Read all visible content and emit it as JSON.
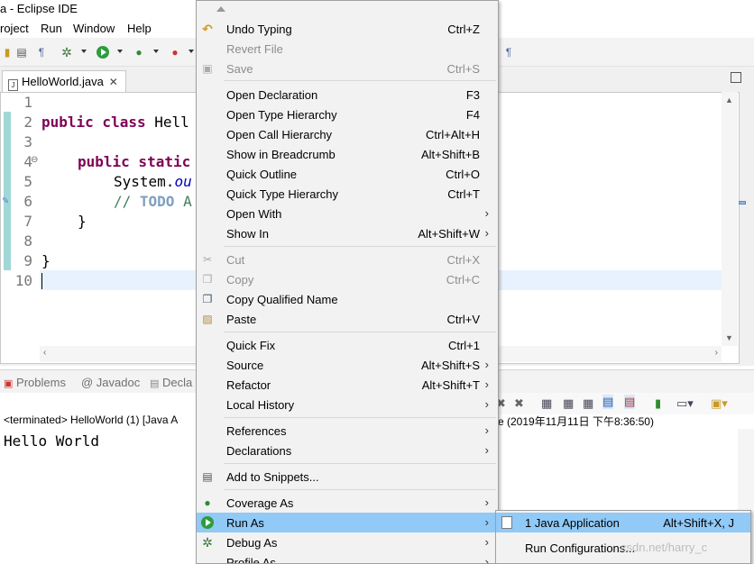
{
  "window": {
    "title": "a - Eclipse IDE"
  },
  "menubar": {
    "items": [
      "roject",
      "Run",
      "Window",
      "Help"
    ]
  },
  "editor": {
    "tab_label": "HelloWorld.java",
    "lines": [
      {
        "num": "1"
      },
      {
        "num": "2"
      },
      {
        "num": "3"
      },
      {
        "num": "4"
      },
      {
        "num": "5"
      },
      {
        "num": "6"
      },
      {
        "num": "7"
      },
      {
        "num": "8"
      },
      {
        "num": "9"
      },
      {
        "num": "10"
      }
    ],
    "code": {
      "l2_kw": "public class ",
      "l2_rest": "Hell",
      "l4_kw": "public static",
      "l5_a": "System.",
      "l5_b": "ou",
      "l6_a": "// ",
      "l6_b": "TODO",
      "l6_c": " A",
      "l7": "}",
      "l9": "}"
    }
  },
  "panel": {
    "tabs": [
      "Problems",
      "@ Javadoc",
      "Decla"
    ],
    "console_head_left": "<terminated> HelloWorld (1) [Java A",
    "console_head_right": "e (2019年11月11日 下午8:36:50)",
    "output": "Hello World"
  },
  "context_menu": {
    "items": [
      {
        "label": "Undo Typing",
        "shortcut": "Ctrl+Z",
        "icon": "undo-icon",
        "disabled": false,
        "submenu": false
      },
      {
        "label": "Revert File",
        "shortcut": "",
        "icon": "",
        "disabled": true,
        "submenu": false
      },
      {
        "label": "Save",
        "shortcut": "Ctrl+S",
        "icon": "save-icon",
        "disabled": true,
        "submenu": false
      },
      {
        "label": "Open Declaration",
        "shortcut": "F3",
        "icon": "",
        "disabled": false,
        "submenu": false
      },
      {
        "label": "Open Type Hierarchy",
        "shortcut": "F4",
        "icon": "",
        "disabled": false,
        "submenu": false
      },
      {
        "label": "Open Call Hierarchy",
        "shortcut": "Ctrl+Alt+H",
        "icon": "",
        "disabled": false,
        "submenu": false
      },
      {
        "label": "Show in Breadcrumb",
        "shortcut": "Alt+Shift+B",
        "icon": "",
        "disabled": false,
        "submenu": false
      },
      {
        "label": "Quick Outline",
        "shortcut": "Ctrl+O",
        "icon": "",
        "disabled": false,
        "submenu": false
      },
      {
        "label": "Quick Type Hierarchy",
        "shortcut": "Ctrl+T",
        "icon": "",
        "disabled": false,
        "submenu": false
      },
      {
        "label": "Open With",
        "shortcut": "",
        "icon": "",
        "disabled": false,
        "submenu": true
      },
      {
        "label": "Show In",
        "shortcut": "Alt+Shift+W",
        "icon": "",
        "disabled": false,
        "submenu": true
      },
      {
        "label": "Cut",
        "shortcut": "Ctrl+X",
        "icon": "cut-icon",
        "disabled": true,
        "submenu": false
      },
      {
        "label": "Copy",
        "shortcut": "Ctrl+C",
        "icon": "copy-icon",
        "disabled": true,
        "submenu": false
      },
      {
        "label": "Copy Qualified Name",
        "shortcut": "",
        "icon": "copy-qualified-icon",
        "disabled": false,
        "submenu": false
      },
      {
        "label": "Paste",
        "shortcut": "Ctrl+V",
        "icon": "paste-icon",
        "disabled": false,
        "submenu": false
      },
      {
        "label": "Quick Fix",
        "shortcut": "Ctrl+1",
        "icon": "",
        "disabled": false,
        "submenu": false
      },
      {
        "label": "Source",
        "shortcut": "Alt+Shift+S",
        "icon": "",
        "disabled": false,
        "submenu": true
      },
      {
        "label": "Refactor",
        "shortcut": "Alt+Shift+T",
        "icon": "",
        "disabled": false,
        "submenu": true
      },
      {
        "label": "Local History",
        "shortcut": "",
        "icon": "",
        "disabled": false,
        "submenu": true
      },
      {
        "label": "References",
        "shortcut": "",
        "icon": "",
        "disabled": false,
        "submenu": true
      },
      {
        "label": "Declarations",
        "shortcut": "",
        "icon": "",
        "disabled": false,
        "submenu": true
      },
      {
        "label": "Add to Snippets...",
        "shortcut": "",
        "icon": "snippets-icon",
        "disabled": false,
        "submenu": false
      },
      {
        "label": "Coverage As",
        "shortcut": "",
        "icon": "coverage-icon",
        "disabled": false,
        "submenu": true
      },
      {
        "label": "Run As",
        "shortcut": "",
        "icon": "run-icon",
        "disabled": false,
        "submenu": true,
        "highlighted": true
      },
      {
        "label": "Debug As",
        "shortcut": "",
        "icon": "debug-icon",
        "disabled": false,
        "submenu": true
      },
      {
        "label": "Profile As",
        "shortcut": "",
        "icon": "",
        "disabled": false,
        "submenu": true
      }
    ]
  },
  "submenu": {
    "items": [
      {
        "label": "1 Java Application",
        "shortcut": "Alt+Shift+X, J",
        "icon": "java-app-icon",
        "highlighted": true
      },
      {
        "label": "Run Configurations...",
        "shortcut": "",
        "icon": ""
      }
    ]
  },
  "watermark": "csdn.net/harry_c",
  "colors": {
    "highlight": "#91c9f7",
    "keyword": "#7f0055",
    "comment": "#3f7f5f"
  }
}
